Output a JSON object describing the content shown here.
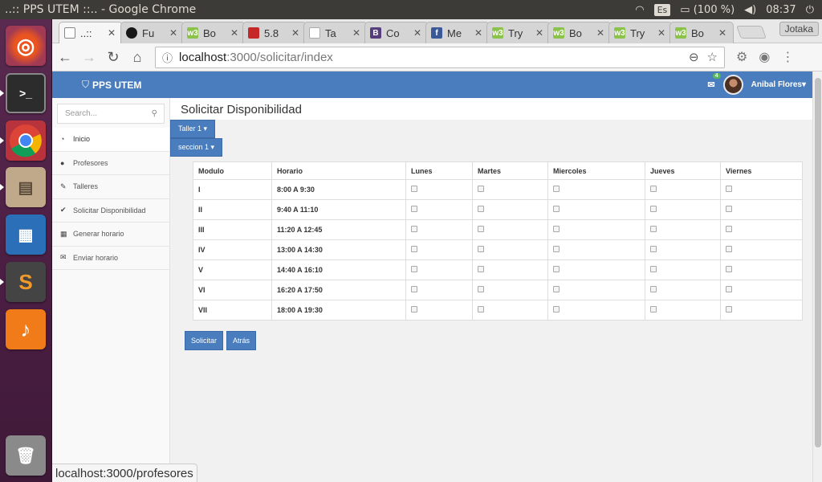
{
  "os": {
    "window_title": "..:: PPS UTEM ::.. - Google Chrome",
    "keyboard": "Es",
    "battery": "(100 %)",
    "time": "08:37"
  },
  "chrome": {
    "tabs": [
      {
        "title": "..::",
        "fav_color": "#ffffff",
        "fav_text": ""
      },
      {
        "title": "Fu",
        "fav_color": "#181717",
        "fav_text": ""
      },
      {
        "title": "Bo",
        "fav_color": "#8bc34a",
        "fav_text": "w3"
      },
      {
        "title": "5.8",
        "fav_color": "#c62828",
        "fav_text": ""
      },
      {
        "title": "Ta",
        "fav_color": "#ffffff",
        "fav_text": ""
      },
      {
        "title": "Co",
        "fav_color": "#563d7c",
        "fav_text": "B"
      },
      {
        "title": "Me",
        "fav_color": "#3b5998",
        "fav_text": "f"
      },
      {
        "title": "Try",
        "fav_color": "#8bc34a",
        "fav_text": "w3"
      },
      {
        "title": "Bo",
        "fav_color": "#8bc34a",
        "fav_text": "w3"
      },
      {
        "title": "Try",
        "fav_color": "#8bc34a",
        "fav_text": "w3"
      },
      {
        "title": "Bo",
        "fav_color": "#8bc34a",
        "fav_text": "w3"
      }
    ],
    "profile": "Jotaka",
    "url_host": "localhost",
    "url_path": ":3000/solicitar/index",
    "status_url": "localhost:3000/profesores"
  },
  "app": {
    "brand": "PPS UTEM",
    "mail_count": "4",
    "user_name": "Anibal Flores",
    "search_placeholder": "Search...",
    "menu": [
      {
        "label": "Inicio",
        "icon": "dashboard-icon"
      },
      {
        "label": "Profesores",
        "icon": "user-icon"
      },
      {
        "label": "Talleres",
        "icon": "pencil-icon"
      },
      {
        "label": "Solicitar Disponibilidad",
        "icon": "check-icon"
      },
      {
        "label": "Generar horario",
        "icon": "calendar-icon"
      },
      {
        "label": "Enviar horario",
        "icon": "envelope-icon"
      }
    ],
    "page_title": "Solicitar Disponibilidad",
    "dropdown_taller": "Taller 1",
    "dropdown_seccion": "seccion 1",
    "table": {
      "headers": [
        "Modulo",
        "Horario",
        "Lunes",
        "Martes",
        "Miercoles",
        "Jueves",
        "Viernes"
      ],
      "rows": [
        {
          "modulo": "I",
          "horario": "8:00 A 9:30"
        },
        {
          "modulo": "II",
          "horario": "9:40 A 11:10"
        },
        {
          "modulo": "III",
          "horario": "11:20 A 12:45"
        },
        {
          "modulo": "IV",
          "horario": "13:00 A 14:30"
        },
        {
          "modulo": "V",
          "horario": "14:40 A 16:10"
        },
        {
          "modulo": "VI",
          "horario": "16:20 A 17:50"
        },
        {
          "modulo": "VII",
          "horario": "18:00 A 19:30"
        }
      ]
    },
    "btn_solicitar": "Solicitar",
    "btn_atras": "Atrás"
  }
}
